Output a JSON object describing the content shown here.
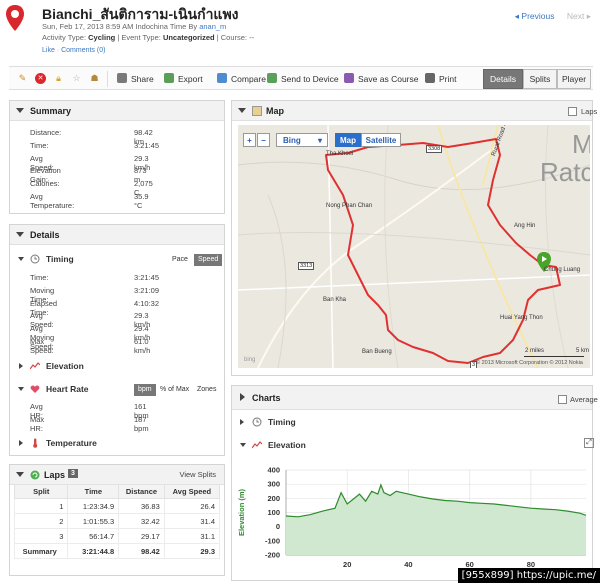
{
  "activity": {
    "title": "Bianchi_สันติการาม-เนินกำแพง",
    "subline_prefix": "Sun, Feb 17, 2013 8:59 AM Indochina Time By ",
    "author": "anan_m",
    "activity_type_label": "Activity Type:",
    "activity_type": "Cycling",
    "event_type_label": "| Event Type:",
    "event_type": "Uncategorized",
    "course_label": "| Course:",
    "course": "--",
    "like": "Like",
    "comments": "Comments (0)"
  },
  "nav": {
    "previous": "Previous",
    "next": "Next"
  },
  "toolbar": {
    "share": "Share",
    "export": "Export",
    "compare": "Compare",
    "send_to_device": "Send to Device",
    "save_as_course": "Save as Course",
    "print": "Print",
    "tabs": [
      "Details",
      "Splits",
      "Player"
    ]
  },
  "summary": {
    "title": "Summary",
    "rows": [
      {
        "k": "Distance:",
        "v": "98.42 km"
      },
      {
        "k": "Time:",
        "v": "3:21:45"
      },
      {
        "k": "Avg Speed:",
        "v": "29.3 km/h"
      },
      {
        "k": "Elevation Gain:",
        "v": "873 m"
      },
      {
        "k": "Calories:",
        "v": "2,075 C"
      },
      {
        "k": "Avg Temperature:",
        "v": "35.9 °C"
      }
    ]
  },
  "details": {
    "title": "Details",
    "timing": {
      "title": "Timing",
      "pace": "Pace",
      "speed": "Speed",
      "rows": [
        {
          "k": "Time:",
          "v": "3:21:45"
        },
        {
          "k": "Moving Time:",
          "v": "3:21:09"
        },
        {
          "k": "Elapsed Time:",
          "v": "4:10:32"
        },
        {
          "k": "Avg Speed:",
          "v": "29.3 km/h"
        },
        {
          "k": "Avg Moving Speed:",
          "v": "29.4 km/h"
        },
        {
          "k": "Max Speed:",
          "v": "61.0 km/h"
        }
      ]
    },
    "elevation": {
      "title": "Elevation"
    },
    "heart_rate": {
      "title": "Heart Rate",
      "bpm": "bpm",
      "pct_max": "% of Max",
      "zones": "Zones",
      "rows": [
        {
          "k": "Avg HR:",
          "v": "161 bpm"
        },
        {
          "k": "Max HR:",
          "v": "187 bpm"
        }
      ]
    },
    "temperature": {
      "title": "Temperature"
    }
  },
  "laps": {
    "title": "Laps",
    "count": "3",
    "view_splits": "View Splits",
    "headers": [
      "Split",
      "Time",
      "Distance",
      "Avg Speed"
    ],
    "rows": [
      [
        "1",
        "1:23:34.9",
        "36.83",
        "26.4"
      ],
      [
        "2",
        "1:01:55.3",
        "32.42",
        "31.4"
      ],
      [
        "3",
        "56:14.7",
        "29.17",
        "31.1"
      ]
    ],
    "summary": [
      "Summary",
      "3:21:44.8",
      "98.42",
      "29.3"
    ]
  },
  "map": {
    "title": "Map",
    "laps_label": "Laps",
    "provider": "Bing",
    "map_btn": "Map",
    "satellite_btn": "Satellite",
    "places": {
      "tha_khoei": "Tha Khoei",
      "nong_phan_chan": "Nong Phan Chan",
      "ban_kha": "Ban Kha",
      "ban_bueng": "Ban Bueng",
      "ang_hin": "Ang Hin",
      "chung_luang": "Chung Luang",
      "huai_yang_thon": "Huai Yang Thon",
      "rural_road": "Rural Road 4016",
      "big_m": "M",
      "big_ratc": "Ratc"
    },
    "roads": {
      "r3308": "3308",
      "r3313": "3313",
      "r3212": "3"
    },
    "scale_mi": "2 miles",
    "scale_km": "5 km",
    "copyright": "© 2013 Microsoft Corporation   © 2012 Nokia",
    "bing_logo": "bing"
  },
  "charts": {
    "title": "Charts",
    "average_label": "Average",
    "timing": "Timing",
    "elevation": "Elevation"
  },
  "chart_data": {
    "type": "area",
    "title": "Elevation",
    "xlabel": "",
    "ylabel": "Elevation (m)",
    "ylim": [
      -200,
      400
    ],
    "yticks": [
      -200,
      -100,
      0,
      100,
      200,
      300,
      400
    ],
    "xticks": [
      20,
      40,
      60,
      80
    ],
    "xlim": [
      0,
      98
    ],
    "x": [
      0,
      4,
      8,
      12,
      16,
      18,
      20,
      24,
      26,
      28,
      30,
      31,
      32,
      34,
      36,
      38,
      40,
      44,
      48,
      52,
      56,
      60,
      64,
      68,
      72,
      76,
      80,
      84,
      88,
      92,
      96,
      98
    ],
    "y": [
      75,
      70,
      85,
      110,
      130,
      240,
      160,
      230,
      180,
      250,
      230,
      295,
      240,
      220,
      250,
      240,
      230,
      210,
      195,
      185,
      180,
      170,
      165,
      160,
      150,
      140,
      130,
      125,
      120,
      110,
      95,
      80
    ]
  },
  "colors": {
    "accent": "#3a78c3",
    "route": "#e53b3b",
    "elevation_line": "#2e8b2e",
    "elevation_fill": "#cfe8cf"
  },
  "watermark": "[955x899] https://upic.me/"
}
